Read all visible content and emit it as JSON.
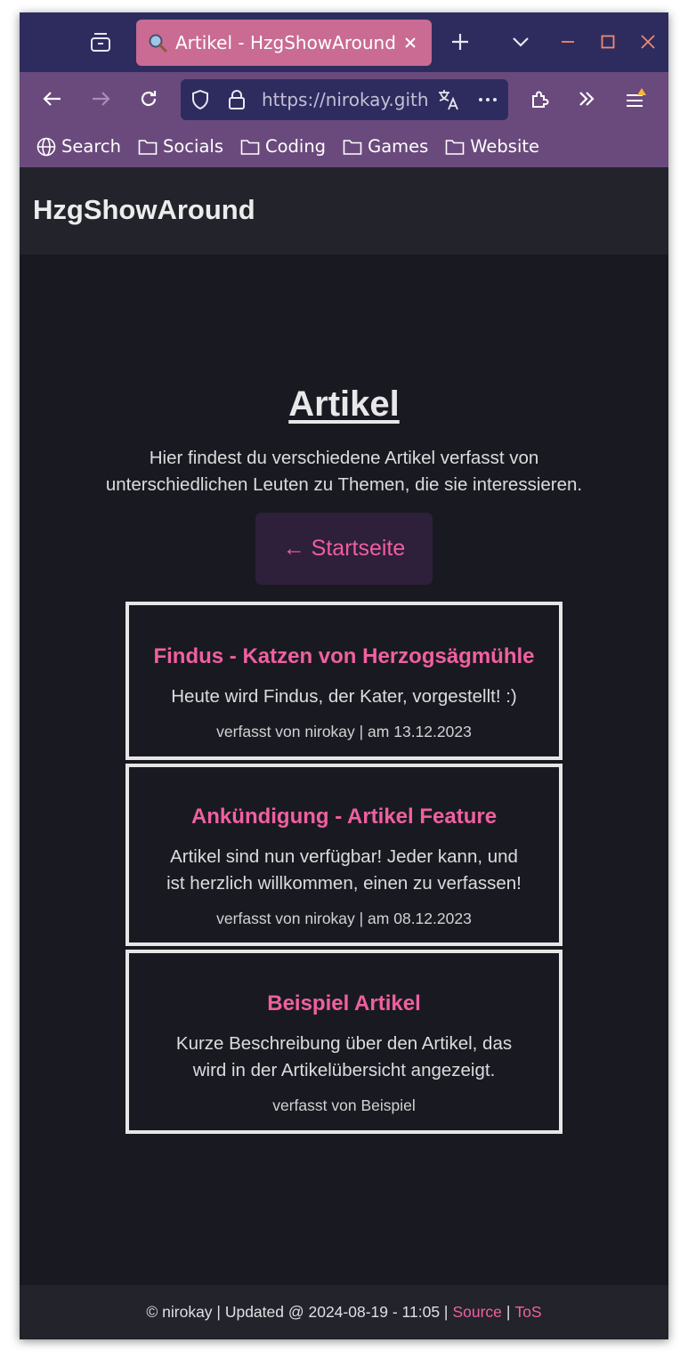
{
  "browser": {
    "tab_title": "Artikel - HzgShowAround",
    "url": "https://nirokay.github.io/HzgShowAround/artikel.html",
    "url_visible": "https://nirokay.gith",
    "bookmarks": [
      {
        "label": "Search",
        "icon": "globe-icon"
      },
      {
        "label": "Socials",
        "icon": "folder-icon"
      },
      {
        "label": "Coding",
        "icon": "folder-icon"
      },
      {
        "label": "Games",
        "icon": "folder-icon"
      },
      {
        "label": "Website",
        "icon": "folder-icon"
      }
    ],
    "colors": {
      "tabbar": "#2e2c5e",
      "active_tab": "#c96b92",
      "toolbar": "#6a4a7c",
      "close_accent": "#f08a6c"
    }
  },
  "site": {
    "title": "HzgShowAround",
    "accent": "#f0609f"
  },
  "page": {
    "heading": "Artikel",
    "intro_line1": "Hier findest du verschiedene Artikel verfasst von",
    "intro_line2": "unterschiedlichen Leuten zu Themen, die sie interessieren.",
    "back_button": "← Startseite"
  },
  "articles": [
    {
      "title": "Findus - Katzen von Herzogsägmühle",
      "desc_lines": [
        "Heute wird Findus, der Kater, vorgestellt! :)"
      ],
      "meta": "verfasst von nirokay | am 13.12.2023"
    },
    {
      "title": "Ankündigung - Artikel Feature",
      "desc_lines": [
        "Artikel sind nun verfügbar! Jeder kann, und",
        "ist herzlich willkommen, einen zu verfassen!"
      ],
      "meta": "verfasst von nirokay | am 08.12.2023"
    },
    {
      "title": "Beispiel Artikel",
      "desc_lines": [
        "Kurze Beschreibung über den Artikel, das",
        "wird in der Artikelübersicht angezeigt."
      ],
      "meta": "verfasst von Beispiel"
    }
  ],
  "footer": {
    "prefix": "© nirokay | Updated @ 2024-08-19 - 11:05 |",
    "source": "Source",
    "divider": "|",
    "tos": "ToS"
  }
}
